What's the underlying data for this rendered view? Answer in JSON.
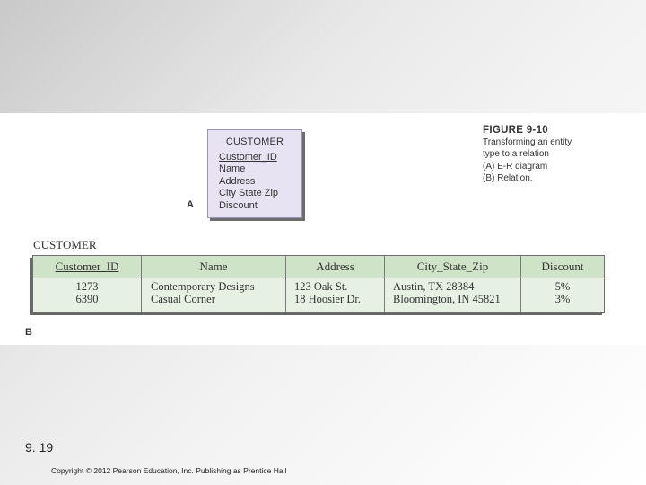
{
  "entity": {
    "title": "CUSTOMER",
    "attributes": [
      "Customer_ID",
      "Name",
      "Address",
      "City State Zip",
      "Discount"
    ]
  },
  "labels": {
    "a": "A",
    "b": "B"
  },
  "caption": {
    "title": "FIGURE 9-10",
    "lines": [
      "Transforming an entity",
      "type to a relation",
      "(A) E-R diagram",
      "(B) Relation."
    ]
  },
  "relation": {
    "name": "CUSTOMER",
    "columns": [
      "Customer_ID",
      "Name",
      "Address",
      "City_State_Zip",
      "Discount"
    ],
    "rows": [
      [
        "1273",
        "Contemporary Designs",
        "123 Oak St.",
        "Austin, TX 28384",
        "5%"
      ],
      [
        "6390",
        "Casual Corner",
        "18 Hoosier Dr.",
        "Bloomington, IN 45821",
        "3%"
      ]
    ]
  },
  "slide": {
    "number": "9. 19",
    "copyright": "Copyright © 2012 Pearson Education, Inc. Publishing as Prentice Hall"
  }
}
